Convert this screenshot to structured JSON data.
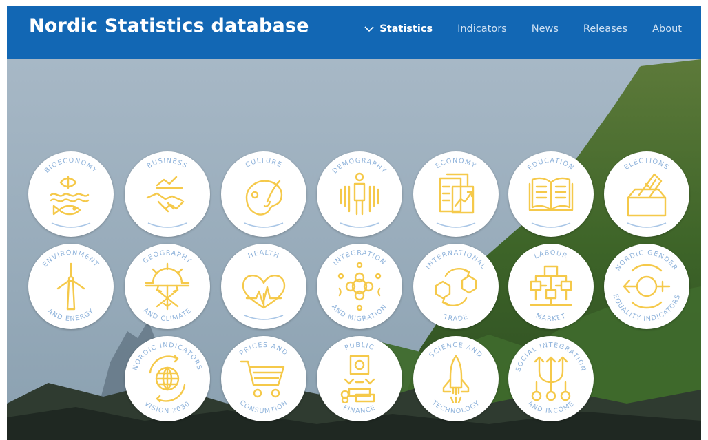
{
  "header": {
    "site_title": "Nordic Statistics database",
    "nav": [
      "Statistics",
      "Indicators",
      "News",
      "Releases",
      "About"
    ],
    "active_nav": "Statistics"
  },
  "colors": {
    "header_bg": "#1267b4",
    "icon_yellow": "#f5c94a",
    "label_blue": "#8fb3db"
  },
  "categories": [
    {
      "top": "BIOECONOMY",
      "bottom": "",
      "icon": "fish-waves-icon"
    },
    {
      "top": "BUSINESS",
      "bottom": "",
      "icon": "handshake-chart-icon"
    },
    {
      "top": "CULTURE",
      "bottom": "",
      "icon": "palette-brush-icon"
    },
    {
      "top": "DEMOGRAPHY",
      "bottom": "",
      "icon": "people-icon"
    },
    {
      "top": "ECONOMY",
      "bottom": "",
      "icon": "trend-chart-icon"
    },
    {
      "top": "EDUCATION",
      "bottom": "",
      "icon": "open-book-icon"
    },
    {
      "top": "ELECTIONS",
      "bottom": "",
      "icon": "ballot-box-icon"
    },
    {
      "top": "ENVIRONMENT",
      "bottom": "AND ENERGY",
      "icon": "wind-turbine-icon"
    },
    {
      "top": "GEOGRAPHY",
      "bottom": "AND CLIMATE",
      "icon": "sun-snowflake-icon"
    },
    {
      "top": "HEALTH",
      "bottom": "",
      "icon": "heart-pulse-icon"
    },
    {
      "top": "INTEGRATION",
      "bottom": "AND MIGRATION",
      "icon": "flower-circle-icon"
    },
    {
      "top": "INTERNATIONAL",
      "bottom": "TRADE",
      "icon": "cube-exchange-icon"
    },
    {
      "top": "LABOUR",
      "bottom": "MARKET",
      "icon": "network-people-icon"
    },
    {
      "top": "NORDIC GENDER",
      "bottom": "EQUALITY INDICATORS",
      "icon": "gender-equality-icon"
    },
    {
      "top": "NORDIC INDICATORS",
      "bottom": "VISION 2030",
      "icon": "globe-arrows-icon"
    },
    {
      "top": "PRICES AND",
      "bottom": "CONSUMTION",
      "icon": "shopping-cart-icon"
    },
    {
      "top": "PUBLIC",
      "bottom": "FINANCE",
      "icon": "coins-vault-icon"
    },
    {
      "top": "SCIENCE AND",
      "bottom": "TECHNOLOGY",
      "icon": "space-shuttle-icon"
    },
    {
      "top": "SOCIAL INTEGRATION",
      "bottom": "AND INCOME",
      "icon": "arrows-circles-icon"
    }
  ]
}
